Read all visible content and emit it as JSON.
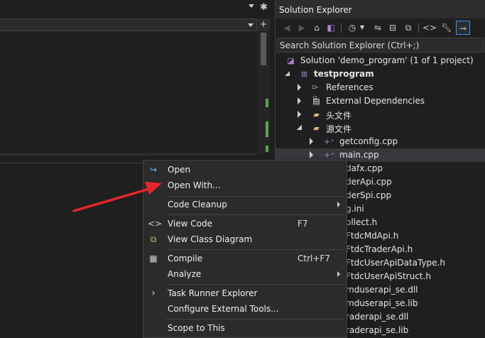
{
  "solution_explorer": {
    "title": "Solution Explorer",
    "search_placeholder": "Search Solution Explorer (Ctrl+;)",
    "toolbar_icons": [
      "back-icon",
      "forward-icon",
      "home-icon",
      "vs-switch-views-icon",
      "pending-changes-icon",
      "sync-icon",
      "collapse-all-icon",
      "show-all-files-icon",
      "code-view-icon",
      "properties-wrench-icon",
      "preview-selected-icon"
    ],
    "tree": [
      {
        "label": "Solution 'demo_program' (1 of 1 project)",
        "icon": "solution-icon",
        "expander": "none",
        "indent": 0
      },
      {
        "label": "testprogram",
        "icon": "cpp-project-icon",
        "expander": "down",
        "indent": 1,
        "bold": true
      },
      {
        "label": "References",
        "icon": "references-icon",
        "expander": "right",
        "indent": 2
      },
      {
        "label": "External Dependencies",
        "icon": "external-deps-icon",
        "expander": "right",
        "indent": 2
      },
      {
        "label": "头文件",
        "icon": "filter-folder-icon",
        "expander": "right",
        "indent": 2
      },
      {
        "label": "源文件",
        "icon": "filter-folder-icon",
        "expander": "down",
        "indent": 2
      },
      {
        "label": "getconfig.cpp",
        "icon": "cpp-file-icon",
        "expander": "right",
        "indent": 3
      },
      {
        "label": "main.cpp",
        "icon": "cpp-file-icon",
        "expander": "right",
        "indent": 3,
        "selected": true
      },
      {
        "label": "dafx.cpp",
        "indent": 4
      },
      {
        "label": "derApi.cpp",
        "indent": 4
      },
      {
        "label": "derSpi.cpp",
        "indent": 4
      },
      {
        "label": "g.ini",
        "indent": 4
      },
      {
        "label": "ollect.h",
        "indent": 4
      },
      {
        "label": "FtdcMdApi.h",
        "indent": 4
      },
      {
        "label": "FtdcTraderApi.h",
        "indent": 4
      },
      {
        "label": "FtdcUserApiDataType.h",
        "indent": 4
      },
      {
        "label": "FtdcUserApiStruct.h",
        "indent": 4
      },
      {
        "label": "mduserapi_se.dll",
        "indent": 4
      },
      {
        "label": "mduserapi_se.lib",
        "indent": 4
      },
      {
        "label": "raderapi_se.dll",
        "indent": 4
      },
      {
        "label": "raderapi_se.lib",
        "indent": 4
      }
    ]
  },
  "context_menu": {
    "items": [
      {
        "label": "Open",
        "icon": "open-icon",
        "shortcut": "",
        "submenu": false
      },
      {
        "label": "Open With...",
        "icon": "",
        "shortcut": "",
        "submenu": false
      },
      {
        "separator": true
      },
      {
        "label": "Code Cleanup",
        "icon": "",
        "shortcut": "",
        "submenu": true
      },
      {
        "separator": true
      },
      {
        "label": "View Code",
        "icon": "code-brackets-icon",
        "shortcut": "F7",
        "submenu": false
      },
      {
        "label": "View Class Diagram",
        "icon": "class-diagram-icon",
        "shortcut": "",
        "submenu": false
      },
      {
        "separator": true
      },
      {
        "label": "Compile",
        "icon": "compile-icon",
        "shortcut": "Ctrl+F7",
        "submenu": false
      },
      {
        "label": "Analyze",
        "icon": "",
        "shortcut": "",
        "submenu": true
      },
      {
        "separator": true
      },
      {
        "label": "Task Runner Explorer",
        "icon": "task-runner-icon",
        "shortcut": "",
        "submenu": false
      },
      {
        "label": "Configure External Tools...",
        "icon": "",
        "shortcut": "",
        "submenu": false
      },
      {
        "separator": true
      },
      {
        "label": "Scope to This",
        "icon": "",
        "shortcut": "",
        "submenu": false
      }
    ]
  },
  "colors": {
    "background": "#1f1f1f",
    "menu_background": "#2b2b2b",
    "selection": "#37373d",
    "accent": "#3794ff",
    "annotation_arrow": "#e8262a",
    "change_marker": "#57a64a"
  }
}
